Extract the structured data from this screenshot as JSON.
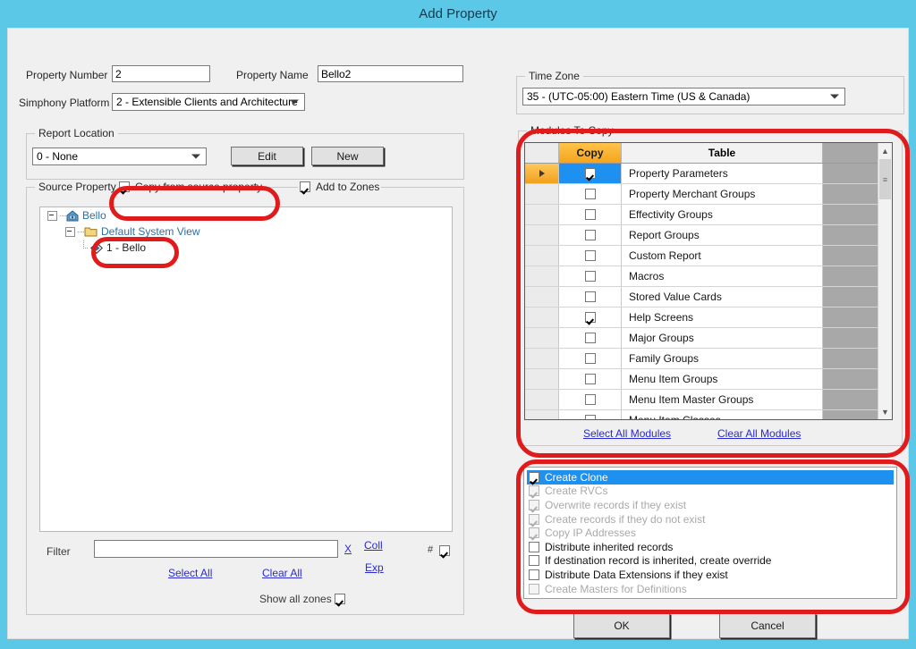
{
  "window": {
    "title": "Add Property"
  },
  "form": {
    "property_number_label": "Property Number",
    "property_number_value": "2",
    "property_name_label": "Property Name",
    "property_name_value": "Bello2",
    "platform_label": "Simphony Platform",
    "platform_value": "2 - Extensible Clients and Architecture"
  },
  "report_location": {
    "group_title": "Report Location",
    "value": "0 - None",
    "edit_button": "Edit",
    "new_button": "New"
  },
  "source_property": {
    "group_title": "Source Property",
    "copy_from_source_label": "Copy from source property",
    "copy_from_source_checked": true,
    "add_to_zones_label": "Add to Zones",
    "add_to_zones_checked": true,
    "tree": [
      {
        "label": "Bello",
        "icon": "property-house-icon",
        "level": 0
      },
      {
        "label": "Default System View",
        "icon": "folder-icon",
        "level": 1
      },
      {
        "label": "1 - Bello",
        "icon": "diamond-icon",
        "level": 2
      }
    ],
    "filter_label": "Filter",
    "filter_value": "",
    "clear_filter_label": "X",
    "collapse_label": "Coll",
    "expand_label": "Exp",
    "hash_label": "#",
    "hash_checked": true,
    "select_all_label": "Select All",
    "clear_all_label": "Clear All",
    "show_all_zones_label": "Show all zones",
    "show_all_zones_checked": true
  },
  "time_zone": {
    "group_title": "Time Zone",
    "value": "35 - (UTC-05:00) Eastern Time (US & Canada)"
  },
  "modules": {
    "group_title": "Modules To Copy",
    "columns": [
      "",
      "Copy",
      "Table",
      ""
    ],
    "rows": [
      {
        "table": "Property Parameters",
        "copy": true,
        "selected": true
      },
      {
        "table": "Property Merchant Groups",
        "copy": false,
        "selected": false
      },
      {
        "table": "Effectivity Groups",
        "copy": false,
        "selected": false
      },
      {
        "table": "Report Groups",
        "copy": false,
        "selected": false
      },
      {
        "table": "Custom Report",
        "copy": false,
        "selected": false
      },
      {
        "table": "Macros",
        "copy": false,
        "selected": false
      },
      {
        "table": "Stored Value Cards",
        "copy": false,
        "selected": false
      },
      {
        "table": "Help Screens",
        "copy": true,
        "selected": false
      },
      {
        "table": "Major Groups",
        "copy": false,
        "selected": false
      },
      {
        "table": "Family Groups",
        "copy": false,
        "selected": false
      },
      {
        "table": "Menu Item Groups",
        "copy": false,
        "selected": false
      },
      {
        "table": "Menu Item Master Groups",
        "copy": false,
        "selected": false
      },
      {
        "table": "Menu Item Classes",
        "copy": false,
        "selected": false
      }
    ],
    "select_all_label": "Select All Modules",
    "clear_all_label": "Clear All Modules",
    "scroll_up_icon": "chevron-up-icon",
    "scroll_down_icon": "chevron-down-icon"
  },
  "options": [
    {
      "label": "Create Clone",
      "checked": true,
      "enabled": true,
      "highlighted": true
    },
    {
      "label": "Create RVCs",
      "checked": true,
      "enabled": false,
      "highlighted": false
    },
    {
      "label": "Overwrite records if they exist",
      "checked": true,
      "enabled": false,
      "highlighted": false
    },
    {
      "label": "Create records if they do not exist",
      "checked": true,
      "enabled": false,
      "highlighted": false
    },
    {
      "label": "Copy IP Addresses",
      "checked": true,
      "enabled": false,
      "highlighted": false
    },
    {
      "label": "Distribute inherited records",
      "checked": false,
      "enabled": true,
      "highlighted": false
    },
    {
      "label": "If destination record is inherited, create override",
      "checked": false,
      "enabled": true,
      "highlighted": false
    },
    {
      "label": "Distribute Data Extensions if they exist",
      "checked": false,
      "enabled": true,
      "highlighted": false
    },
    {
      "label": "Create Masters for Definitions",
      "checked": false,
      "enabled": false,
      "highlighted": false
    }
  ],
  "footer": {
    "ok_label": "OK",
    "cancel_label": "Cancel"
  },
  "colors": {
    "title_bar": "#5bc8e8",
    "annotation": "#e01b1b",
    "selection": "#1e90ef",
    "copy_header": "#f5a41c",
    "link": "#2a2ad0"
  }
}
